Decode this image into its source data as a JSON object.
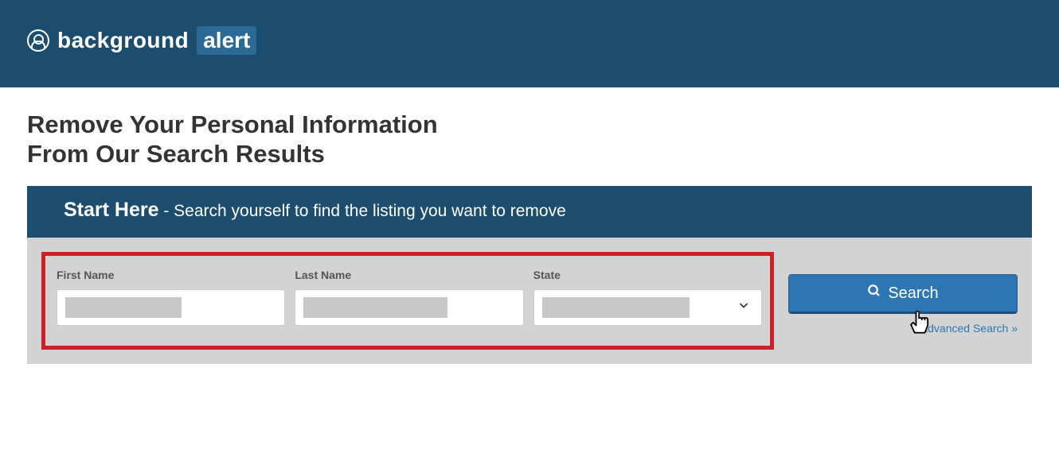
{
  "header": {
    "brand_first": "background",
    "brand_second": "alert"
  },
  "page": {
    "title_line1": "Remove Your Personal Information",
    "title_line2": "From Our Search Results"
  },
  "search": {
    "heading_bold": "Start Here",
    "heading_rest": " - Search yourself to find the listing you want to remove",
    "first_name_label": "First Name",
    "last_name_label": "Last Name",
    "state_label": "State",
    "first_name_value": "",
    "last_name_value": "",
    "state_value": "",
    "search_button": "Search",
    "advanced_link": "Advanced Search »"
  }
}
